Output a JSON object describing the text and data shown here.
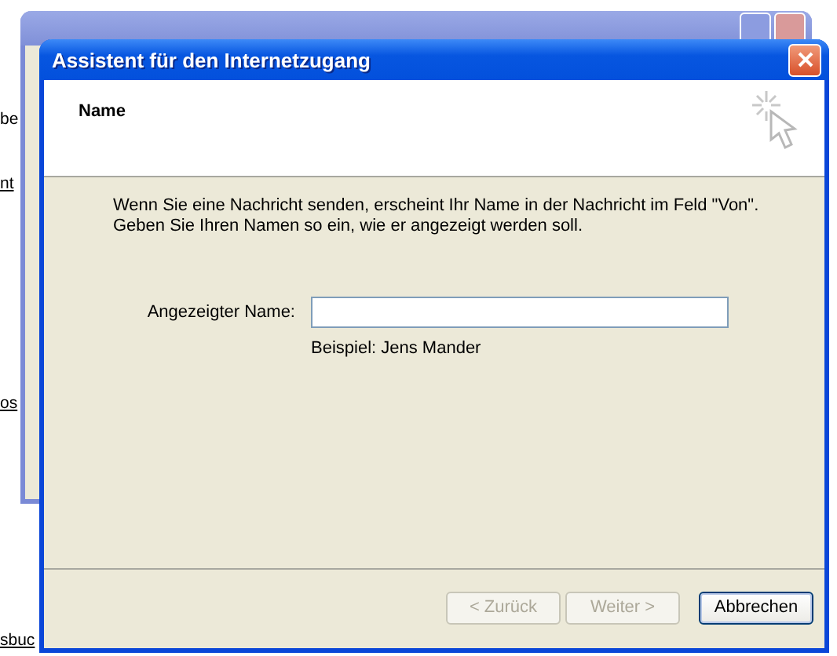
{
  "background_page": {
    "fragments": [
      {
        "text": "be",
        "link": false
      },
      {
        "text": "nt",
        "link": true
      },
      {
        "text": "os",
        "link": true
      },
      {
        "text": "sbuc",
        "link": true
      }
    ]
  },
  "dialog": {
    "title": "Assistent für den Internetzugang",
    "header": {
      "title": "Name"
    },
    "intro": [
      "Wenn Sie eine Nachricht senden, erscheint Ihr Name in der Nachricht im Feld \"Von\".",
      "Geben Sie Ihren Namen so ein, wie er angezeigt werden soll."
    ],
    "field": {
      "label": "Angezeigter Name:"
    },
    "example": "Beispiel: Jens Mander",
    "buttons": [
      {
        "label": "< Zurück",
        "disabled": true,
        "default": false
      },
      {
        "label": "Weiter >",
        "disabled": true,
        "default": false
      },
      {
        "label": "Abbrechen",
        "disabled": false,
        "default": true
      }
    ]
  }
}
